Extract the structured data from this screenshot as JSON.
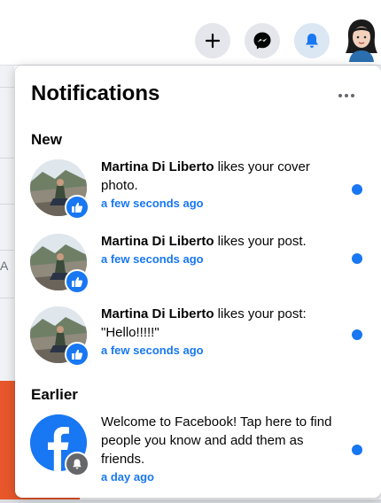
{
  "background": {
    "fragment_text": "A"
  },
  "nav": {
    "create_icon": "plus-icon",
    "messenger_icon": "messenger-icon",
    "notifications_icon": "bell-icon",
    "account_icon": "avatar"
  },
  "panel": {
    "title": "Notifications",
    "more_icon": "more-horizontal-icon",
    "sections": {
      "new": "New",
      "earlier": "Earlier"
    },
    "items": [
      {
        "name": "Martina Di Liberto",
        "action": " likes your cover photo.",
        "time": "a few seconds ago",
        "badge_icon": "thumbs-up-icon",
        "unread": true
      },
      {
        "name": "Martina Di Liberto",
        "action": " likes your post.",
        "time": "a few seconds ago",
        "badge_icon": "thumbs-up-icon",
        "unread": true
      },
      {
        "name": "Martina Di Liberto",
        "action": " likes your post: \"Hello!!!!!\"",
        "time": "a few seconds ago",
        "badge_icon": "thumbs-up-icon",
        "unread": true
      },
      {
        "name": "",
        "action": "Welcome to Facebook! Tap here to find people you know and add them as friends.",
        "time": "a day ago",
        "badge_icon": "bell-icon",
        "unread": true
      }
    ]
  },
  "colors": {
    "accent": "#1877f2",
    "text": "#050505",
    "orange_bg": "#e8572b"
  }
}
